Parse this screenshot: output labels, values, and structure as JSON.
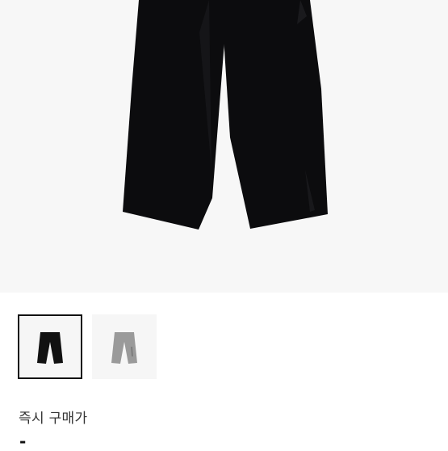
{
  "product": {
    "gallery": {
      "selected_index": 0,
      "thumbnails": [
        {
          "icon": "black-pants-thumbnail",
          "color": "#111111"
        },
        {
          "icon": "gray-pants-thumbnail",
          "color": "#9a9a9a"
        }
      ]
    },
    "price": {
      "label": "즉시 구매가",
      "value": "-"
    }
  }
}
